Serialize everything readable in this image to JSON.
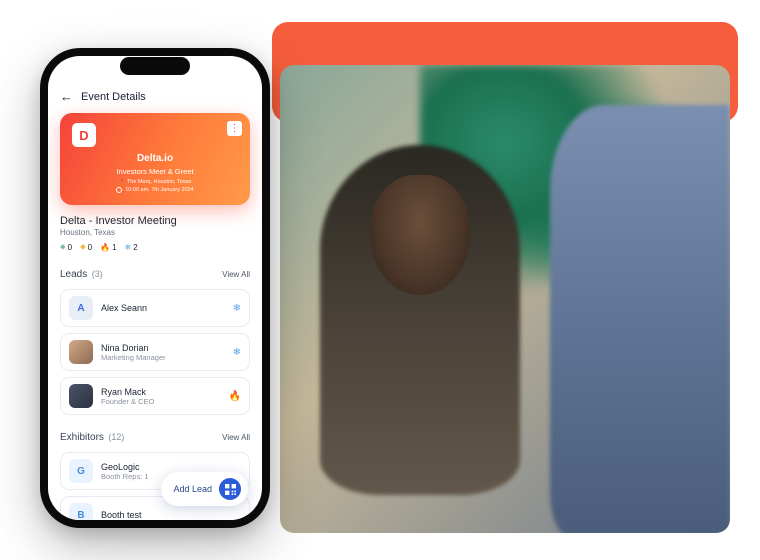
{
  "header": {
    "title": "Event Details"
  },
  "card": {
    "company": "Delta.io",
    "subtitle": "Investors Meet & Greet",
    "location": "The Marq, Houston, Texas",
    "time": "10:00 am, 7th January 2024"
  },
  "meeting": {
    "title": "Delta - Investor Meeting",
    "location": "Houston, Texas",
    "stats": {
      "coldish": "0",
      "warm": "0",
      "hot": "1",
      "cold": "2"
    }
  },
  "leads": {
    "label": "Leads",
    "count": "(3)",
    "viewAll": "View All",
    "items": [
      {
        "initial": "A",
        "name": "Alex Seann",
        "sub": "",
        "icon": "snow"
      },
      {
        "initial": "",
        "name": "Nina Dorian",
        "sub": "Marketing Manager",
        "icon": "snow",
        "avatarClass": "photo1"
      },
      {
        "initial": "",
        "name": "Ryan Mack",
        "sub": "Founder & CEO",
        "icon": "fire",
        "avatarClass": "photo2"
      }
    ]
  },
  "exhibitors": {
    "label": "Exhibitors",
    "count": "(12)",
    "viewAll": "View All",
    "items": [
      {
        "initial": "G",
        "name": "GeoLogic",
        "sub": "Booth Reps: 1",
        "avatarClass": "geo"
      },
      {
        "initial": "B",
        "name": "Booth test",
        "sub": "",
        "avatarClass": "geo"
      }
    ]
  },
  "fab": {
    "label": "Add Lead"
  },
  "colors": {
    "accent": "#f65d3c",
    "cold": "#5aa7e8",
    "hot": "#f06a3a",
    "warm": "#f5b342"
  }
}
